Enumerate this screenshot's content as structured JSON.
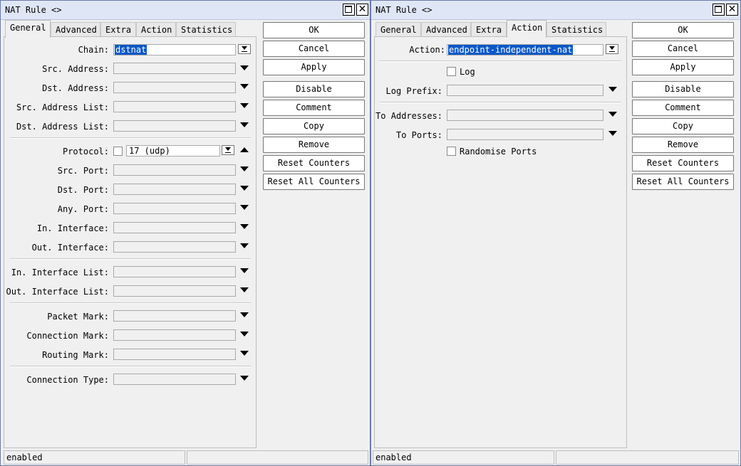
{
  "left": {
    "title": "NAT Rule <>",
    "tabs": [
      "General",
      "Advanced",
      "Extra",
      "Action",
      "Statistics"
    ],
    "active_tab": "General",
    "fields": {
      "chain": {
        "label": "Chain:",
        "value": "dstnat"
      },
      "src_address": {
        "label": "Src. Address:",
        "value": ""
      },
      "dst_address": {
        "label": "Dst. Address:",
        "value": ""
      },
      "src_address_list": {
        "label": "Src. Address List:",
        "value": ""
      },
      "dst_address_list": {
        "label": "Dst. Address List:",
        "value": ""
      },
      "protocol": {
        "label": "Protocol:",
        "value": "17 (udp)"
      },
      "src_port": {
        "label": "Src. Port:",
        "value": ""
      },
      "dst_port": {
        "label": "Dst. Port:",
        "value": ""
      },
      "any_port": {
        "label": "Any. Port:",
        "value": ""
      },
      "in_interface": {
        "label": "In. Interface:",
        "value": ""
      },
      "out_interface": {
        "label": "Out. Interface:",
        "value": ""
      },
      "in_interface_list": {
        "label": "In. Interface List:",
        "value": ""
      },
      "out_interface_list": {
        "label": "Out. Interface List:",
        "value": ""
      },
      "packet_mark": {
        "label": "Packet Mark:",
        "value": ""
      },
      "connection_mark": {
        "label": "Connection Mark:",
        "value": ""
      },
      "routing_mark": {
        "label": "Routing Mark:",
        "value": ""
      },
      "connection_type": {
        "label": "Connection Type:",
        "value": ""
      }
    },
    "status": "enabled"
  },
  "right": {
    "title": "NAT Rule <>",
    "tabs": [
      "General",
      "Advanced",
      "Extra",
      "Action",
      "Statistics"
    ],
    "active_tab": "Action",
    "fields": {
      "action": {
        "label": "Action:",
        "value": "endpoint-independent-nat"
      },
      "log": {
        "label": "Log",
        "checked": false
      },
      "log_prefix": {
        "label": "Log Prefix:",
        "value": ""
      },
      "to_addresses": {
        "label": "To Addresses:",
        "value": ""
      },
      "to_ports": {
        "label": "To Ports:",
        "value": ""
      },
      "randomise_ports": {
        "label": "Randomise Ports",
        "checked": false
      }
    },
    "status": "enabled"
  },
  "buttons": {
    "ok": "OK",
    "cancel": "Cancel",
    "apply": "Apply",
    "disable": "Disable",
    "comment": "Comment",
    "copy": "Copy",
    "remove": "Remove",
    "reset_counters": "Reset Counters",
    "reset_all_counters": "Reset All Counters"
  },
  "titlebar_icons": [
    "maximize-icon",
    "close-icon"
  ]
}
